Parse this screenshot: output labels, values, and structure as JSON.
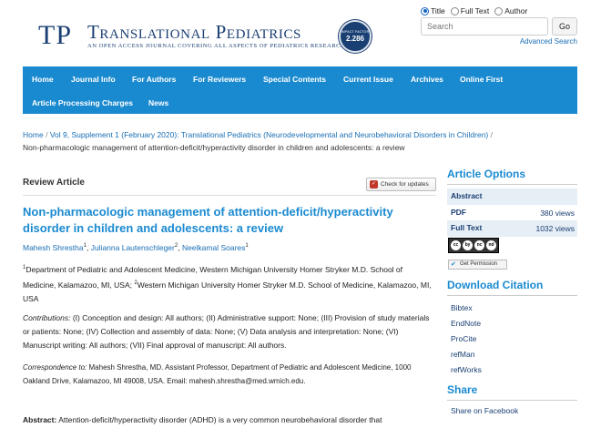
{
  "journal": {
    "mark": "TP",
    "title": "Translational Pediatrics",
    "subtitle": "AN OPEN ACCESS JOURNAL COVERING ALL ASPECTS OF PEDIATRICS RESEARCH",
    "impact_label": "IMPACT FACTOR",
    "impact_value": "2.286"
  },
  "search": {
    "options": [
      "Title",
      "Full Text",
      "Author"
    ],
    "selected": "Title",
    "placeholder": "Search",
    "go_label": "Go",
    "advanced_label": "Advanced Search"
  },
  "nav": {
    "items": [
      "Home",
      "Journal Info",
      "For Authors",
      "For Reviewers",
      "Special Contents",
      "Current Issue",
      "Archives",
      "Online First",
      "Article Processing Charges",
      "News"
    ]
  },
  "breadcrumb": {
    "home": "Home",
    "sep": "/",
    "issue": "Vol 9, Supplement 1 (February 2020): Translational Pediatrics (Neurodevelopmental and Neurobehavioral Disorders in Children)",
    "current": "Non-pharmacologic management of attention-deficit/hyperactivity disorder in children and adolescents: a review"
  },
  "article": {
    "type": "Review Article",
    "check_updates": "Check for updates",
    "title": "Non-pharmacologic management of attention-deficit/hyperactivity disorder in children and adolescents: a review",
    "authors": [
      {
        "name": "Mahesh Shrestha",
        "sup": "1"
      },
      {
        "name": "Julianna Lautenschleger",
        "sup": "2"
      },
      {
        "name": "Neelkamal Soares",
        "sup": "1"
      }
    ],
    "affil_sup1": "1",
    "affil_1": "Department of Pediatric and Adolescent Medicine, Western Michigan University Homer Stryker M.D. School of Medicine, Kalamazoo, MI, USA;",
    "affil_sup2": "2",
    "affil_2": "Western Michigan University Homer Stryker M.D. School of Medicine, Kalamazoo, MI, USA",
    "contrib_label": "Contributions:",
    "contrib_text": "(I) Conception and design: All authors; (II) Administrative support: None; (III) Provision of study materials or patients: None; (IV) Collection and assembly of data: None; (V) Data analysis and interpretation: None; (VI) Manuscript writing: All authors; (VII) Final approval of manuscript: All authors.",
    "corr_label": "Correspondence to:",
    "corr_text": "Mahesh Shrestha, MD. Assistant Professor, Department of Pediatric and Adolescent Medicine, 1000 Oakland Drive, Kalamazoo, MI 49008, USA. Email: mahesh.shrestha@med.wmich.edu.",
    "abstract_label": "Abstract:",
    "abstract_text": "Attention-deficit/hyperactivity disorder (ADHD) is a very common neurobehavioral disorder that"
  },
  "sidebar": {
    "options_heading": "Article Options",
    "options": [
      {
        "label": "Abstract",
        "views": ""
      },
      {
        "label": "PDF",
        "views": "380 views"
      },
      {
        "label": "Full Text",
        "views": "1032 views"
      }
    ],
    "cc_icons": [
      "cc",
      "by",
      "nc",
      "nd"
    ],
    "permission_label": "Get Permission",
    "citation_heading": "Download Citation",
    "citations": [
      "Bibtex",
      "EndNote",
      "ProCite",
      "refMan",
      "refWorks"
    ],
    "share_heading": "Share",
    "share_items": [
      "Share on Facebook"
    ]
  }
}
